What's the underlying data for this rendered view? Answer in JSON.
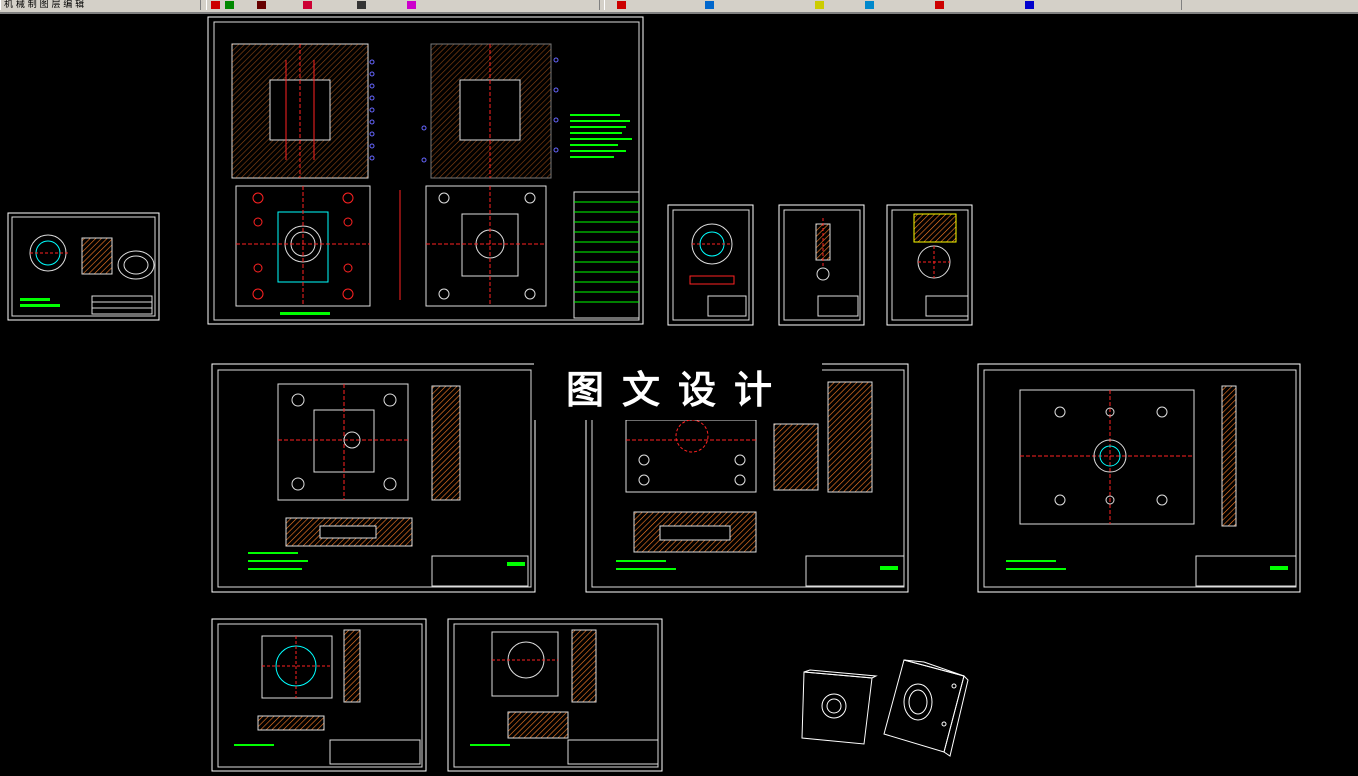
{
  "toolbar": {
    "layer_text": "机 械 制 图 层 编 辑",
    "icons": [
      "draw-icon",
      "layer-icon",
      "color-icon",
      "linetype-icon",
      "pen-icon",
      "arc-icon",
      "circle-icon",
      "text-icon",
      "dim-icon",
      "zoom-icon",
      "pan-icon",
      "snap-icon"
    ]
  },
  "watermark": {
    "text": "图文设计"
  },
  "colors": {
    "background": "#000000",
    "sheet_border": "#ffffff",
    "hatch": "#ff7f27",
    "green": "#00ff00",
    "cyan": "#00ffff",
    "red": "#ff2020",
    "blue": "#6060ff",
    "yellow": "#ffff00",
    "magenta": "#ff00ff"
  }
}
